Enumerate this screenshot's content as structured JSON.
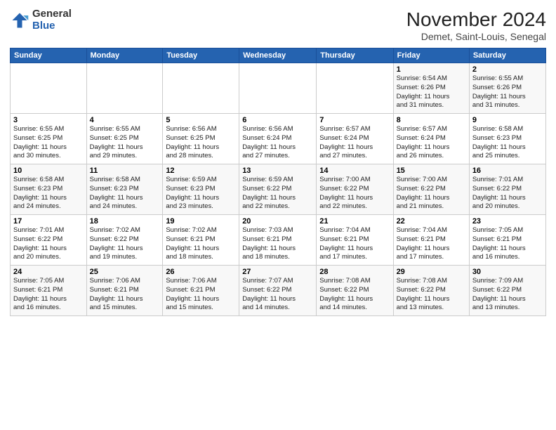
{
  "logo": {
    "general": "General",
    "blue": "Blue"
  },
  "title": "November 2024",
  "location": "Demet, Saint-Louis, Senegal",
  "days_of_week": [
    "Sunday",
    "Monday",
    "Tuesday",
    "Wednesday",
    "Thursday",
    "Friday",
    "Saturday"
  ],
  "weeks": [
    [
      {
        "day": "",
        "info": ""
      },
      {
        "day": "",
        "info": ""
      },
      {
        "day": "",
        "info": ""
      },
      {
        "day": "",
        "info": ""
      },
      {
        "day": "",
        "info": ""
      },
      {
        "day": "1",
        "info": "Sunrise: 6:54 AM\nSunset: 6:26 PM\nDaylight: 11 hours\nand 31 minutes."
      },
      {
        "day": "2",
        "info": "Sunrise: 6:55 AM\nSunset: 6:26 PM\nDaylight: 11 hours\nand 31 minutes."
      }
    ],
    [
      {
        "day": "3",
        "info": "Sunrise: 6:55 AM\nSunset: 6:25 PM\nDaylight: 11 hours\nand 30 minutes."
      },
      {
        "day": "4",
        "info": "Sunrise: 6:55 AM\nSunset: 6:25 PM\nDaylight: 11 hours\nand 29 minutes."
      },
      {
        "day": "5",
        "info": "Sunrise: 6:56 AM\nSunset: 6:25 PM\nDaylight: 11 hours\nand 28 minutes."
      },
      {
        "day": "6",
        "info": "Sunrise: 6:56 AM\nSunset: 6:24 PM\nDaylight: 11 hours\nand 27 minutes."
      },
      {
        "day": "7",
        "info": "Sunrise: 6:57 AM\nSunset: 6:24 PM\nDaylight: 11 hours\nand 27 minutes."
      },
      {
        "day": "8",
        "info": "Sunrise: 6:57 AM\nSunset: 6:24 PM\nDaylight: 11 hours\nand 26 minutes."
      },
      {
        "day": "9",
        "info": "Sunrise: 6:58 AM\nSunset: 6:23 PM\nDaylight: 11 hours\nand 25 minutes."
      }
    ],
    [
      {
        "day": "10",
        "info": "Sunrise: 6:58 AM\nSunset: 6:23 PM\nDaylight: 11 hours\nand 24 minutes."
      },
      {
        "day": "11",
        "info": "Sunrise: 6:58 AM\nSunset: 6:23 PM\nDaylight: 11 hours\nand 24 minutes."
      },
      {
        "day": "12",
        "info": "Sunrise: 6:59 AM\nSunset: 6:23 PM\nDaylight: 11 hours\nand 23 minutes."
      },
      {
        "day": "13",
        "info": "Sunrise: 6:59 AM\nSunset: 6:22 PM\nDaylight: 11 hours\nand 22 minutes."
      },
      {
        "day": "14",
        "info": "Sunrise: 7:00 AM\nSunset: 6:22 PM\nDaylight: 11 hours\nand 22 minutes."
      },
      {
        "day": "15",
        "info": "Sunrise: 7:00 AM\nSunset: 6:22 PM\nDaylight: 11 hours\nand 21 minutes."
      },
      {
        "day": "16",
        "info": "Sunrise: 7:01 AM\nSunset: 6:22 PM\nDaylight: 11 hours\nand 20 minutes."
      }
    ],
    [
      {
        "day": "17",
        "info": "Sunrise: 7:01 AM\nSunset: 6:22 PM\nDaylight: 11 hours\nand 20 minutes."
      },
      {
        "day": "18",
        "info": "Sunrise: 7:02 AM\nSunset: 6:22 PM\nDaylight: 11 hours\nand 19 minutes."
      },
      {
        "day": "19",
        "info": "Sunrise: 7:02 AM\nSunset: 6:21 PM\nDaylight: 11 hours\nand 18 minutes."
      },
      {
        "day": "20",
        "info": "Sunrise: 7:03 AM\nSunset: 6:21 PM\nDaylight: 11 hours\nand 18 minutes."
      },
      {
        "day": "21",
        "info": "Sunrise: 7:04 AM\nSunset: 6:21 PM\nDaylight: 11 hours\nand 17 minutes."
      },
      {
        "day": "22",
        "info": "Sunrise: 7:04 AM\nSunset: 6:21 PM\nDaylight: 11 hours\nand 17 minutes."
      },
      {
        "day": "23",
        "info": "Sunrise: 7:05 AM\nSunset: 6:21 PM\nDaylight: 11 hours\nand 16 minutes."
      }
    ],
    [
      {
        "day": "24",
        "info": "Sunrise: 7:05 AM\nSunset: 6:21 PM\nDaylight: 11 hours\nand 16 minutes."
      },
      {
        "day": "25",
        "info": "Sunrise: 7:06 AM\nSunset: 6:21 PM\nDaylight: 11 hours\nand 15 minutes."
      },
      {
        "day": "26",
        "info": "Sunrise: 7:06 AM\nSunset: 6:21 PM\nDaylight: 11 hours\nand 15 minutes."
      },
      {
        "day": "27",
        "info": "Sunrise: 7:07 AM\nSunset: 6:22 PM\nDaylight: 11 hours\nand 14 minutes."
      },
      {
        "day": "28",
        "info": "Sunrise: 7:08 AM\nSunset: 6:22 PM\nDaylight: 11 hours\nand 14 minutes."
      },
      {
        "day": "29",
        "info": "Sunrise: 7:08 AM\nSunset: 6:22 PM\nDaylight: 11 hours\nand 13 minutes."
      },
      {
        "day": "30",
        "info": "Sunrise: 7:09 AM\nSunset: 6:22 PM\nDaylight: 11 hours\nand 13 minutes."
      }
    ]
  ]
}
